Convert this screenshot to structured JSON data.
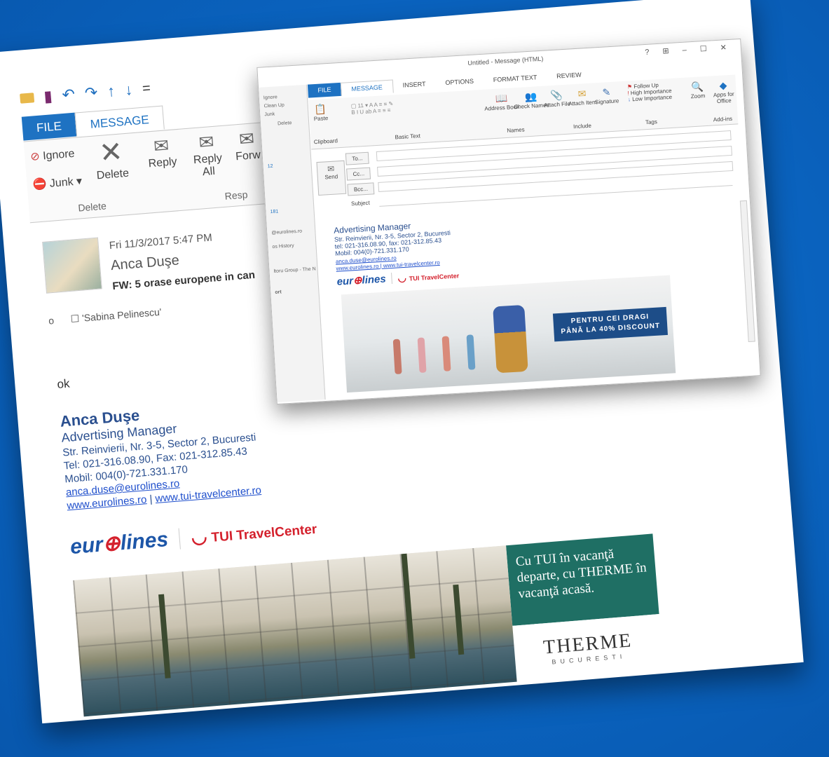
{
  "back_window": {
    "quick_access": {
      "mail_icon": "envelope-icon",
      "save_icon": "save-icon",
      "undo_icon": "undo-icon",
      "redo_icon": "redo-icon",
      "up_icon": "arrow-up-icon",
      "down_icon": "arrow-down-icon",
      "customize": "="
    },
    "tabs": {
      "file": "FILE",
      "message": "MESSAGE"
    },
    "ribbon": {
      "ignore": "Ignore",
      "junk": "Junk",
      "delete": "Delete",
      "reply": "Reply",
      "reply_all": "Reply All",
      "forward": "Forw",
      "group_delete": "Delete",
      "group_respond": "Resp"
    },
    "header": {
      "date": "Fri 11/3/2017 5:47 PM",
      "from": "Anca Duşe",
      "subject": "FW: 5 orase europene in can",
      "to_prefix": "o",
      "to": "'Sabina Pelinescu'"
    },
    "body_text": "ok",
    "signature": {
      "name": "Anca Duşe",
      "title": "Advertising Manager",
      "address": "Str. Reinvierii, Nr. 3-5, Sector 2, Bucuresti",
      "tel": "Tel: 021-316.08.90, Fax: 021-312.85.43",
      "mobile": "Mobil: 004(0)-721.331.170",
      "email": "anca.duse@eurolines.ro",
      "web1": "www.eurolines.ro",
      "sep": "|",
      "web2": "www.tui-travelcenter.ro"
    },
    "logos": {
      "eurolines": "eurolines",
      "tui": "TUI TravelCenter"
    },
    "banner": {
      "text": "Cu TUI în vacanţă departe, cu THERME în vacanţă acasă.",
      "brand": "THERME",
      "city": "BUCURESTI"
    }
  },
  "front_window": {
    "title": "Untitled - Message (HTML)",
    "window_controls": "? ⊞ – ☐ ✕",
    "tabs": {
      "file": "FILE",
      "message": "MESSAGE",
      "insert": "INSERT",
      "options": "OPTIONS",
      "format": "FORMAT TEXT",
      "review": "REVIEW"
    },
    "ribbon": {
      "paste": "Paste",
      "clipboard": "Clipboard",
      "basic_text": "Basic Text",
      "address_book": "Address Book",
      "check_names": "Check Names",
      "names": "Names",
      "attach_file": "Attach File",
      "attach_item": "Attach Item",
      "signature": "Signature",
      "include": "Include",
      "follow_up": "Follow Up",
      "high_importance": "High Importance",
      "low_importance": "Low Importance",
      "tags": "Tags",
      "zoom": "Zoom",
      "apps": "Apps for Office",
      "add_ins": "Add-ins"
    },
    "fields": {
      "send": "Send",
      "to": "To...",
      "cc": "Cc...",
      "bcc": "Bcc...",
      "subject": "Subject"
    },
    "left_pane": {
      "ignore": "Ignore",
      "cleanup": "Clean Up",
      "junk": "Junk",
      "delete": "Delete",
      "n1": "12",
      "n2": "181",
      "a1": "@eurolines.ro",
      "a2": "os History",
      "a3": "ltoru Group - The N",
      "a4": "ort"
    },
    "signature": {
      "title": "Advertising Manager",
      "address": "Str. Reinvierii, Nr. 3-5, Sector 2, Bucuresti",
      "tel": "tel: 021-316.08.90, fax: 021-312.85.43",
      "mobile": "Mobil: 004(0)-721.331.170",
      "email": "anca.duse@eurolines.ro",
      "webs": "www.eurolines.ro | www.tui-travelcenter.ro"
    },
    "promo": {
      "line1": "PENTRU CEI DRAGI",
      "line2": "PÂNĂ LA 40% DISCOUNT"
    }
  }
}
